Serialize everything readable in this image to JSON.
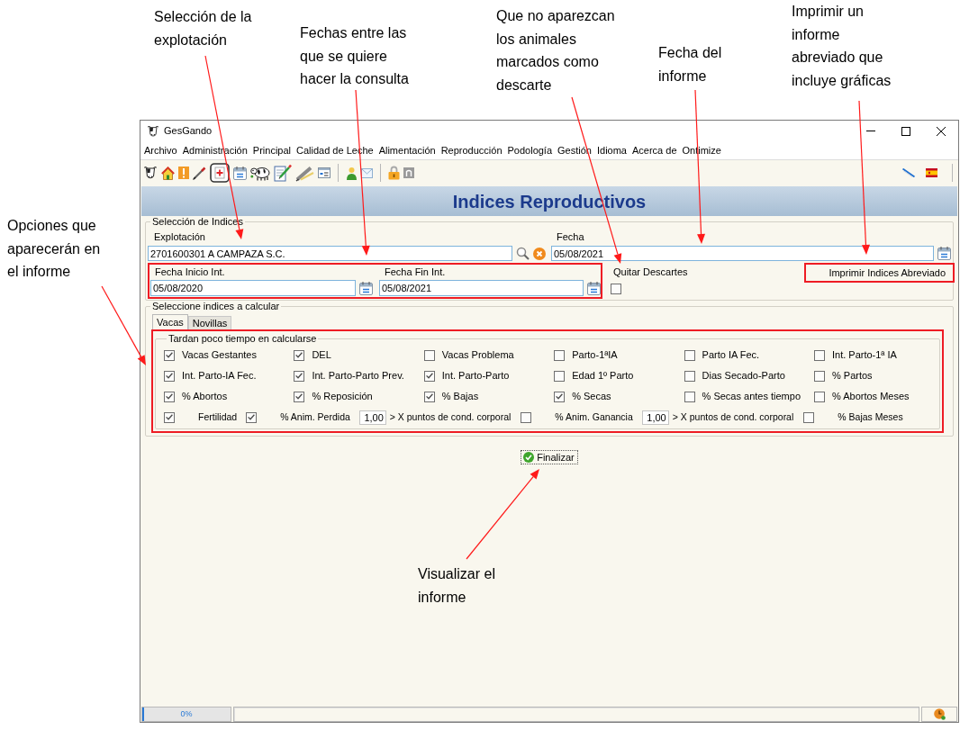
{
  "annotations": [
    {
      "lines": [
        "Selección de la",
        "explotación"
      ]
    },
    {
      "lines": [
        "Fechas entre las",
        "que se quiere",
        "hacer la consulta"
      ]
    },
    {
      "lines": [
        "Que no aparezcan",
        "los animales",
        "marcados como",
        "descarte"
      ]
    },
    {
      "lines": [
        "Fecha del",
        "informe"
      ]
    },
    {
      "lines": [
        "Imprimir un",
        "informe",
        "abreviado que",
        "incluye gráficas"
      ]
    },
    {
      "lines": [
        "Opciones que",
        "aparecerán en",
        "el informe"
      ]
    },
    {
      "lines": [
        "Visualizar el",
        "informe"
      ]
    }
  ],
  "window": {
    "title": "GesGando"
  },
  "menu": [
    "Archivo",
    "Administración",
    "Principal",
    "Calidad de Leche",
    "Alimentación",
    "Reproducción",
    "Podología",
    "Gestión",
    "Idioma",
    "Acerca de",
    "Ontimize"
  ],
  "toolbar": {
    "left": [
      {
        "kind": "cow"
      },
      {
        "kind": "house"
      },
      {
        "kind": "alert"
      },
      {
        "kind": "syringe"
      },
      {
        "kind": "medical"
      },
      {
        "kind": "calendar"
      },
      {
        "kind": "cattle"
      },
      {
        "kind": "notepad"
      },
      {
        "kind": "pen"
      },
      {
        "kind": "window"
      },
      {
        "kind": "person"
      },
      {
        "kind": "envelope"
      },
      {
        "kind": "lock"
      },
      {
        "kind": "tile"
      }
    ],
    "right": [
      {
        "kind": "line"
      },
      {
        "kind": "flag"
      }
    ]
  },
  "header": {
    "title": "Indices Reproductivos"
  },
  "selection": {
    "legend": "Selección de Indices",
    "farm": {
      "label": "Explotación",
      "value": "2701600301 A CAMPAZA S.C."
    },
    "date": {
      "label": "Fecha",
      "value": "05/08/2021"
    },
    "start_date": {
      "label": "Fecha Inicio Int.",
      "value": "05/08/2020"
    },
    "end_date": {
      "label": "Fecha Fin Int.",
      "value": "05/08/2021"
    },
    "exclude_culled": {
      "label": "Quitar Descartes",
      "checked": false
    },
    "print_button": "Imprimir Indices Abreviado"
  },
  "indices": {
    "legend": "Seleccione indices a calcular",
    "tabs": [
      {
        "label": "Vacas",
        "selected": true
      },
      {
        "label": "Novillas",
        "selected": false
      }
    ],
    "group": {
      "legend": "Tardan poco tiempo en calcularse",
      "rows": [
        [
          {
            "label": "Vacas Gestantes",
            "checked": true
          },
          {
            "label": "DEL",
            "checked": true
          },
          {
            "label": "Vacas Problema",
            "checked": false
          },
          {
            "label": "Parto-1ªIA",
            "checked": false
          },
          {
            "label": "Parto IA Fec.",
            "checked": false
          },
          {
            "label": "Int. Parto-1ª IA",
            "checked": false
          }
        ],
        [
          {
            "label": "Int. Parto-IA Fec.",
            "checked": true
          },
          {
            "label": "Int. Parto-Parto Prev.",
            "checked": true
          },
          {
            "label": "Int. Parto-Parto",
            "checked": true
          },
          {
            "label": "Edad 1º Parto",
            "checked": false
          },
          {
            "label": "Dias Secado-Parto",
            "checked": false
          },
          {
            "label": "% Partos",
            "checked": false
          }
        ],
        [
          {
            "label": "% Abortos",
            "checked": true
          },
          {
            "label": "% Reposición",
            "checked": true
          },
          {
            "label": "% Bajas",
            "checked": true
          },
          {
            "label": "% Secas",
            "checked": true
          },
          {
            "label": "% Secas antes tiempo",
            "checked": false
          },
          {
            "label": "% Abortos Meses",
            "checked": false
          }
        ]
      ],
      "extra_row": [
        {
          "kind": "check",
          "label": "Fertilidad",
          "checked": true
        },
        {
          "kind": "check",
          "label": "% Anim. Perdida",
          "checked": true
        },
        {
          "kind": "number",
          "value": "1,00"
        },
        {
          "kind": "text",
          "text": "> X puntos de cond. corporal"
        },
        {
          "kind": "check",
          "label": "% Anim. Ganancia",
          "checked": false
        },
        {
          "kind": "number",
          "value": "1,00"
        },
        {
          "kind": "text",
          "text": "> X puntos de cond. corporal"
        },
        {
          "kind": "check",
          "label": "% Bajas Meses",
          "checked": false
        }
      ]
    }
  },
  "finish_button": "Finalizar",
  "status_bar": {
    "progress": {
      "level": 0,
      "reading": "0%"
    }
  }
}
